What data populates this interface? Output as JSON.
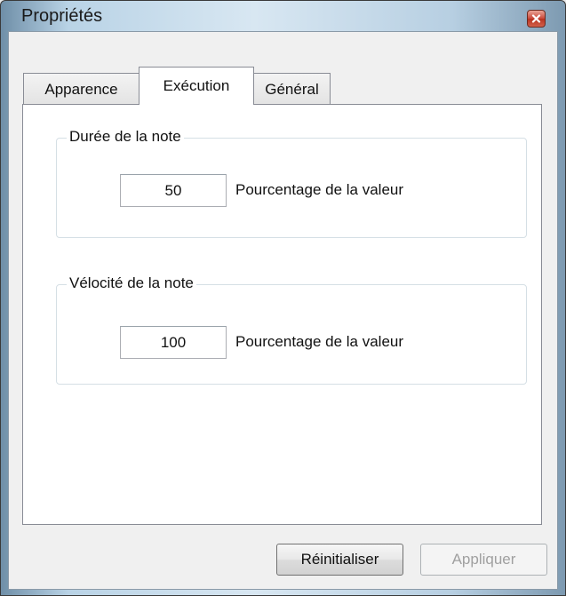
{
  "window": {
    "title": "Propriétés",
    "close_icon": "close-icon"
  },
  "tabs": [
    {
      "label": "Apparence",
      "active": false
    },
    {
      "label": "Exécution",
      "active": true
    },
    {
      "label": "Général",
      "active": false
    }
  ],
  "groups": {
    "duration": {
      "title": "Durée de la note",
      "value": "50",
      "unit_label": "Pourcentage de la valeur"
    },
    "velocity": {
      "title": "Vélocité de la note",
      "value": "100",
      "unit_label": "Pourcentage de la valeur"
    }
  },
  "buttons": {
    "reset_label": "Réinitialiser",
    "apply_label": "Appliquer",
    "apply_enabled": false
  },
  "colors": {
    "close_button": "#c9483a",
    "panel_background": "#ffffff",
    "dialog_background": "#f0f0f0"
  }
}
